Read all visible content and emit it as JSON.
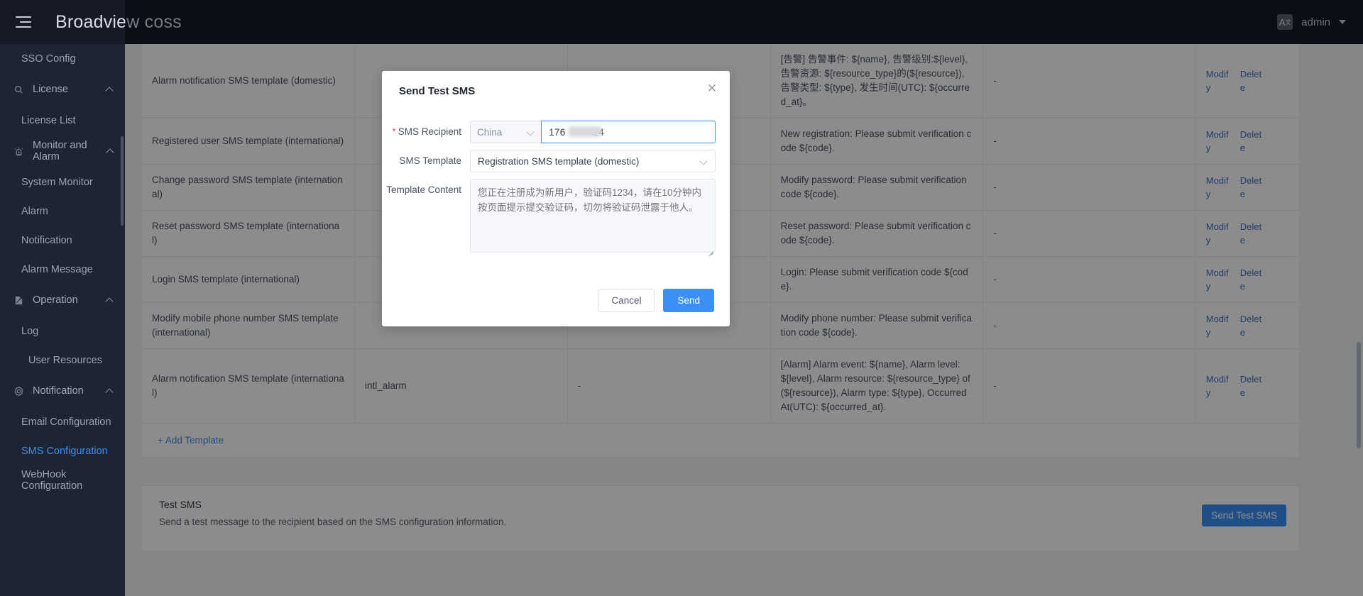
{
  "topbar": {
    "menu_icon": "hamburger-icon",
    "title": "Broadview coss",
    "lang_icon": "language-icon",
    "lang_glyph": "A",
    "lang_sup": "文",
    "user": "admin"
  },
  "sidebar": {
    "items": [
      {
        "kind": "item",
        "label": "SSO Config",
        "icon": null,
        "active": false,
        "indent": 1
      },
      {
        "kind": "group",
        "label": "License",
        "icon": "license-icon",
        "expanded": true
      },
      {
        "kind": "item",
        "label": "License List",
        "icon": null,
        "active": false,
        "indent": 1
      },
      {
        "kind": "group",
        "label": "Monitor and Alarm",
        "icon": "alarm-icon",
        "expanded": true
      },
      {
        "kind": "item",
        "label": "System Monitor",
        "icon": null,
        "active": false,
        "indent": 1
      },
      {
        "kind": "item",
        "label": "Alarm",
        "icon": null,
        "active": false,
        "indent": 1
      },
      {
        "kind": "item",
        "label": "Notification",
        "icon": null,
        "active": false,
        "indent": 1
      },
      {
        "kind": "item",
        "label": "Alarm Message",
        "icon": null,
        "active": false,
        "indent": 1
      },
      {
        "kind": "group",
        "label": "Operation",
        "icon": "document-icon",
        "expanded": true
      },
      {
        "kind": "item",
        "label": "Log",
        "icon": null,
        "active": false,
        "indent": 1
      },
      {
        "kind": "item",
        "label": "User Resources",
        "icon": null,
        "active": false,
        "indent": 2
      },
      {
        "kind": "group",
        "label": "Notification",
        "icon": "gear-icon",
        "expanded": true
      },
      {
        "kind": "item",
        "label": "Email Configuration",
        "icon": null,
        "active": false,
        "indent": 1
      },
      {
        "kind": "item",
        "label": "SMS Configuration",
        "icon": null,
        "active": true,
        "indent": 1
      },
      {
        "kind": "item",
        "label": "WebHook Configuration",
        "icon": null,
        "active": false,
        "indent": 1
      }
    ]
  },
  "table": {
    "rows": [
      {
        "name": "Alarm notification SMS template (domestic)",
        "code": "",
        "sign": "",
        "content": "[告警] 告警事件: ${name}, 告警级别:${level}, 告警资源: ${resource_type}的(${resource}), 告警类型: ${type}, 发生时间(UTC): ${occurred_at}。",
        "extra": "-",
        "actions": [
          "Modify",
          "Delete"
        ]
      },
      {
        "name": "Registered user SMS template (international)",
        "code": "",
        "sign": "",
        "content": "New registration: Please submit verification code ${code}.",
        "extra": "-",
        "actions": [
          "Modify",
          "Delete"
        ]
      },
      {
        "name": "Change password SMS template (international)",
        "code": "",
        "sign": "",
        "content": "Modify password: Please submit verification code ${code}.",
        "extra": "-",
        "actions": [
          "Modify",
          "Delete"
        ]
      },
      {
        "name": "Reset password SMS template (international)",
        "code": "",
        "sign": "",
        "content": "Reset password: Please submit verification code ${code}.",
        "extra": "-",
        "actions": [
          "Modify",
          "Delete"
        ]
      },
      {
        "name": "Login SMS template (international)",
        "code": "",
        "sign": "",
        "content": "Login: Please submit verification code ${code}.",
        "extra": "-",
        "actions": [
          "Modify",
          "Delete"
        ]
      },
      {
        "name": "Modify mobile phone number SMS template (international)",
        "code": "",
        "sign": "",
        "content": "Modify phone number: Please submit verification code ${code}.",
        "extra": "-",
        "actions": [
          "Modify",
          "Delete"
        ]
      },
      {
        "name": "Alarm notification SMS template (international)",
        "code": "intl_alarm",
        "sign": "-",
        "content": "[Alarm] Alarm event: ${name}, Alarm level: ${level}, Alarm resource: ${resource_type} of (${resource}), Alarm type: ${type}, Occurred At(UTC): ${occurred_at}.",
        "extra": "-",
        "actions": [
          "Modify",
          "Delete"
        ]
      }
    ],
    "add_template_label": "+ Add Template"
  },
  "test_panel": {
    "title": "Test SMS",
    "description": "Send a test message to the recipient based on the SMS configuration information.",
    "button_label": "Send Test SMS"
  },
  "modal": {
    "title": "Send Test SMS",
    "close_icon": "close-icon",
    "recipient": {
      "label": "SMS Recipient",
      "required": true,
      "country": "China",
      "phone_value": "176          24"
    },
    "template": {
      "label": "SMS Template",
      "selected": "Registration SMS template (domestic)"
    },
    "content": {
      "label": "Template Content",
      "placeholder": "您正在注册成为新用户，验证码1234，请在10分钟内按页面提示提交验证码，切勿将验证码泄露于他人。",
      "value": ""
    },
    "cancel_label": "Cancel",
    "send_label": "Send"
  },
  "colors": {
    "accent": "#3b8ff5",
    "sidebar_bg": "#1d2433",
    "topbar_bg": "#151a26",
    "required": "#f05252",
    "link": "#4071b8"
  }
}
